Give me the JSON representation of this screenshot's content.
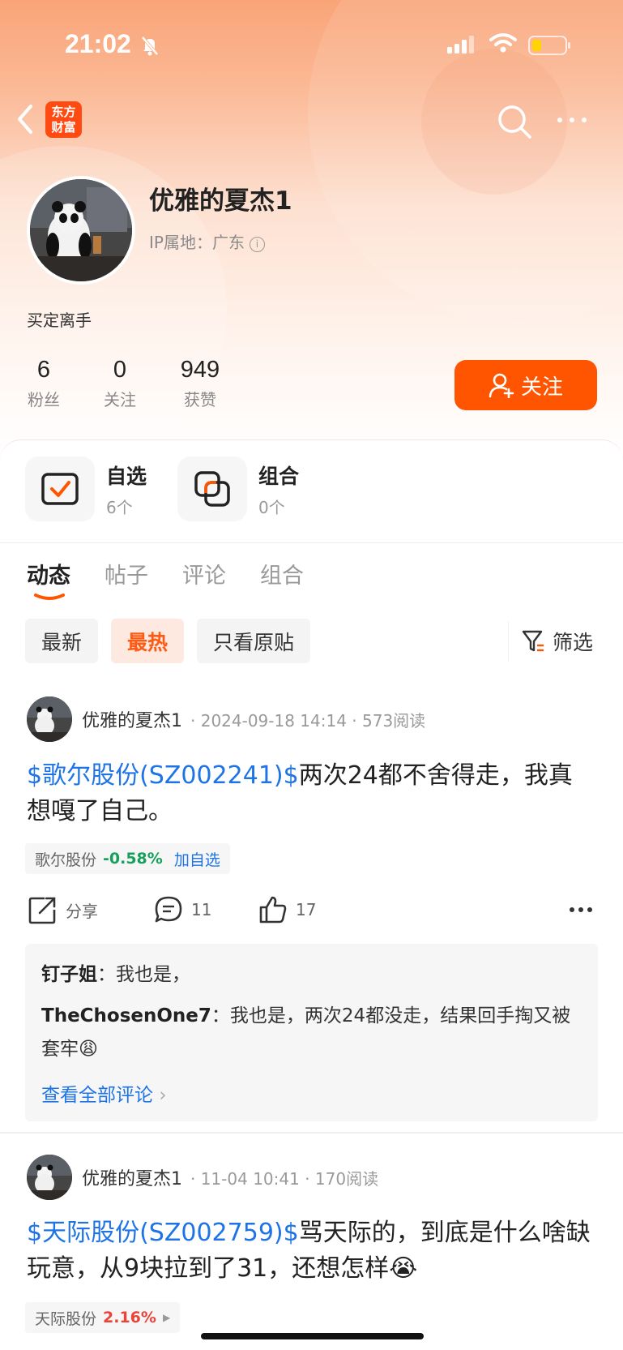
{
  "status_bar": {
    "time": "21:02"
  },
  "brand": {
    "logo_line1": "东方",
    "logo_line2": "财富"
  },
  "profile": {
    "username": "优雅的夏杰1",
    "ip_location": "IP属地：广东",
    "bio": "买定离手",
    "stats": [
      {
        "value": "6",
        "label": "粉丝"
      },
      {
        "value": "0",
        "label": "关注"
      },
      {
        "value": "949",
        "label": "获赞"
      }
    ],
    "follow_label": "关注"
  },
  "quick_cards": [
    {
      "title": "自选",
      "sub": "6个"
    },
    {
      "title": "组合",
      "sub": "0个"
    }
  ],
  "tabs": [
    "动态",
    "帖子",
    "评论",
    "组合"
  ],
  "active_tab": "动态",
  "filters": [
    "最新",
    "最热",
    "只看原贴"
  ],
  "active_filter": "最热",
  "filter_button": "筛选",
  "posts": [
    {
      "author": "优雅的夏杰1",
      "meta": "· 2024-09-18 14:14 · 573阅读",
      "stock_tag": "$歌尔股份(SZ002241)$",
      "text": "两次24都不舍得走，我真想嘎了自己。",
      "chip_name": "歌尔股份",
      "chip_change": "-0.58%",
      "chip_action": "加自选",
      "share_label": "分享",
      "comment_count": "11",
      "like_count": "17",
      "comments": [
        {
          "user": "钉子姐",
          "text": "我也是，"
        },
        {
          "user": "TheChosenOne7",
          "text": "我也是，两次24都没走，结果回手掏又被套牢😩"
        }
      ],
      "see_all": "查看全部评论"
    },
    {
      "author": "优雅的夏杰1",
      "meta": "· 11-04 10:41 · 170阅读",
      "stock_tag": "$天际股份(SZ002759)$",
      "text": "骂天际的，到底是什么啥缺玩意，从9块拉到了31，还想怎样😭",
      "chip_name": "天际股份",
      "chip_change": "2.16%"
    }
  ],
  "colors": {
    "accent": "#ff5500",
    "link": "#1e74e4",
    "down": "#17a05d",
    "up": "#e9433a"
  }
}
